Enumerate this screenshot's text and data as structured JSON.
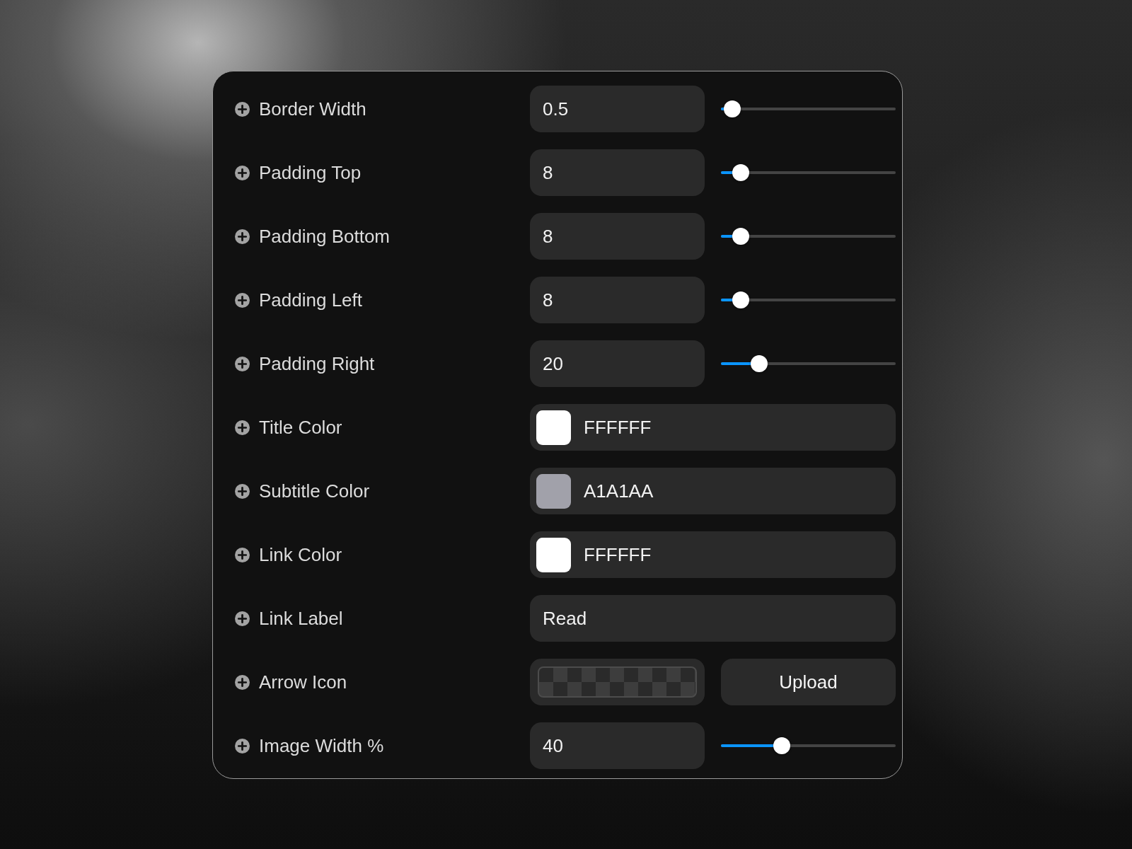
{
  "properties": [
    {
      "kind": "number",
      "label": "Border Width",
      "value": "0.5",
      "level": 0.02
    },
    {
      "kind": "number",
      "label": "Padding Top",
      "value": "8",
      "level": 0.07
    },
    {
      "kind": "number",
      "label": "Padding Bottom",
      "value": "8",
      "level": 0.07
    },
    {
      "kind": "number",
      "label": "Padding Left",
      "value": "8",
      "level": 0.07
    },
    {
      "kind": "number",
      "label": "Padding Right",
      "value": "20",
      "level": 0.19
    },
    {
      "kind": "color",
      "label": "Title Color",
      "value": "FFFFFF",
      "color": "#ffffff"
    },
    {
      "kind": "color",
      "label": "Subtitle Color",
      "value": "A1A1AA",
      "color": "#a1a1aa"
    },
    {
      "kind": "color",
      "label": "Link Color",
      "value": "FFFFFF",
      "color": "#ffffff"
    },
    {
      "kind": "text",
      "label": "Link Label",
      "value": "Read"
    },
    {
      "kind": "upload",
      "label": "Arrow Icon",
      "button": "Upload"
    },
    {
      "kind": "number",
      "label": "Image Width %",
      "value": "40",
      "level": 0.33
    }
  ]
}
